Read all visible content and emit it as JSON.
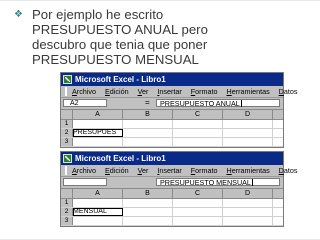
{
  "slide": {
    "bullet_text": "Por ejemplo he escrito PRESUPUESTO ANUAL pero descubro que tenia que poner PRESUPUESTO MENSUAL"
  },
  "colors": {
    "bullet": "#2d8a8a",
    "titlebar": "#0a2a8a",
    "chrome": "#c0c0c0"
  },
  "excel_1": {
    "title": "Microsoft Excel - Libro1",
    "menu": [
      "Archivo",
      "Edición",
      "Ver",
      "Insertar",
      "Formato",
      "Herramientas",
      "Datos"
    ],
    "namebox": "A2",
    "equals": "=",
    "formula": "PRESUPUESTO ANUAL",
    "columns": [
      "A",
      "B",
      "C",
      "D"
    ],
    "rows": [
      "1",
      "2",
      "3"
    ],
    "cell_a2": "PRESUPUES"
  },
  "excel_2": {
    "title": "Microsoft Excel - Libro1",
    "menu": [
      "Archivo",
      "Edición",
      "Ver",
      "Insertar",
      "Formato",
      "Herramientas",
      "Datos"
    ],
    "formula": "PRESUPUESTO MENSUAL",
    "columns": [
      "A",
      "B",
      "C",
      "D"
    ],
    "rows": [
      "1",
      "2",
      "3"
    ],
    "cell_a2": "MENSUAL"
  }
}
